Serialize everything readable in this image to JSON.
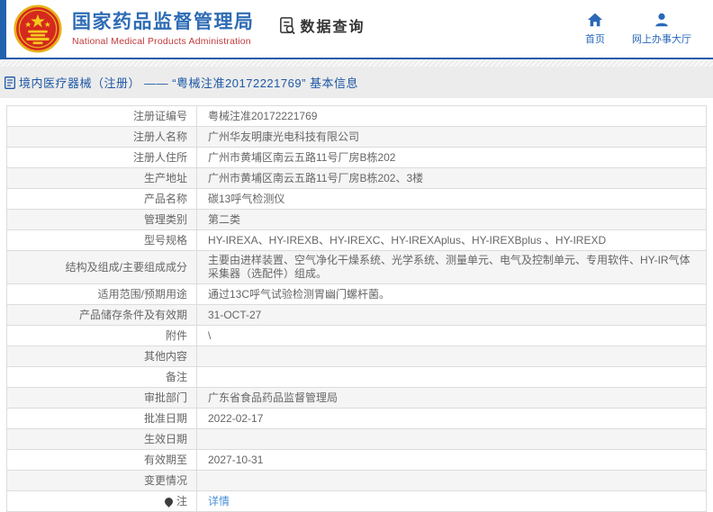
{
  "header": {
    "agency_name_cn": "国家药品监督管理局",
    "agency_name_en": "National Medical Products Administration",
    "section_title": "数据查询",
    "nav_home": "首页",
    "nav_hall": "网上办事大厅"
  },
  "breadcrumb": {
    "text": "境内医疗器械（注册） —— “粤械注准20172221769” 基本信息"
  },
  "detail_table": {
    "rows": [
      {
        "label": "注册证编号",
        "value": "粤械注准20172221769"
      },
      {
        "label": "注册人名称",
        "value": "广州华友明康光电科技有限公司"
      },
      {
        "label": "注册人住所",
        "value": "广州市黄埔区南云五路11号厂房B栋202"
      },
      {
        "label": "生产地址",
        "value": "广州市黄埔区南云五路11号厂房B栋202、3楼"
      },
      {
        "label": "产品名称",
        "value": "碳13呼气检测仪"
      },
      {
        "label": "管理类别",
        "value": "第二类"
      },
      {
        "label": "型号规格",
        "value": "HY-IREXA、HY-IREXB、HY-IREXC、HY-IREXAplus、HY-IREXBplus 、HY-IREXD"
      },
      {
        "label": "结构及组成/主要组成成分",
        "value": "主要由进样装置、空气净化干燥系统、光学系统、测量单元、电气及控制单元、专用软件、HY-IR气体采集器（选配件）组成。"
      },
      {
        "label": "适用范围/预期用途",
        "value": "通过13C呼气试验检测胃幽门螺杆菌。"
      },
      {
        "label": "产品储存条件及有效期",
        "value": "31-OCT-27"
      },
      {
        "label": "附件",
        "value": "\\"
      },
      {
        "label": "其他内容",
        "value": ""
      },
      {
        "label": "备注",
        "value": ""
      },
      {
        "label": "审批部门",
        "value": "广东省食品药品监督管理局"
      },
      {
        "label": "批准日期",
        "value": "2022-02-17"
      },
      {
        "label": "生效日期",
        "value": ""
      },
      {
        "label": "有效期至",
        "value": "2027-10-31"
      },
      {
        "label": "变更情况",
        "value": ""
      },
      {
        "label": "注",
        "value": "详情",
        "value_is_link": true,
        "label_icon": "note-icon"
      }
    ]
  },
  "colors": {
    "accent_blue": "#2062ae",
    "title_blue": "#2e6cb5",
    "subtitle_red": "#c23a3c",
    "breadcrumb_text_blue": "#1d57a5",
    "link_blue": "#4a90d9",
    "row_alt_gray": "#f5f5f5",
    "border_gray": "#dcdcdc"
  }
}
